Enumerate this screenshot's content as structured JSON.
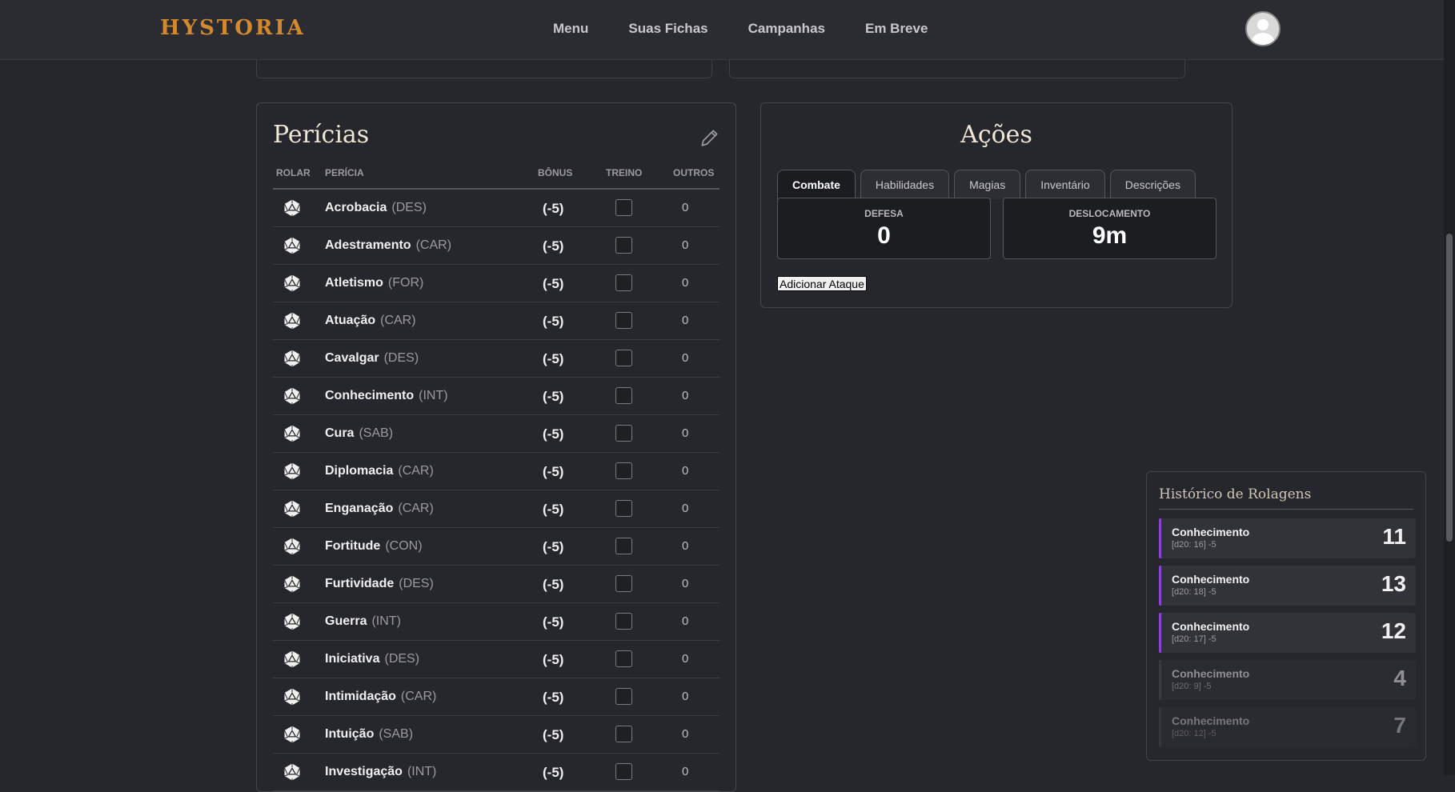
{
  "header": {
    "logo": "HYSTORIA",
    "nav": [
      "Menu",
      "Suas Fichas",
      "Campanhas",
      "Em Breve"
    ]
  },
  "skills": {
    "title": "Perícias",
    "columns": {
      "rolar": "ROLAR",
      "pericia": "PERÍCIA",
      "bonus": "BÔNUS",
      "treino": "TREINO",
      "outros": "OUTROS"
    },
    "rows": [
      {
        "name": "Acrobacia",
        "attr": "(DES)",
        "bonus": "(-5)",
        "outros": "0"
      },
      {
        "name": "Adestramento",
        "attr": "(CAR)",
        "bonus": "(-5)",
        "outros": "0"
      },
      {
        "name": "Atletismo",
        "attr": "(FOR)",
        "bonus": "(-5)",
        "outros": "0"
      },
      {
        "name": "Atuação",
        "attr": "(CAR)",
        "bonus": "(-5)",
        "outros": "0"
      },
      {
        "name": "Cavalgar",
        "attr": "(DES)",
        "bonus": "(-5)",
        "outros": "0"
      },
      {
        "name": "Conhecimento",
        "attr": "(INT)",
        "bonus": "(-5)",
        "outros": "0"
      },
      {
        "name": "Cura",
        "attr": "(SAB)",
        "bonus": "(-5)",
        "outros": "0"
      },
      {
        "name": "Diplomacia",
        "attr": "(CAR)",
        "bonus": "(-5)",
        "outros": "0"
      },
      {
        "name": "Enganação",
        "attr": "(CAR)",
        "bonus": "(-5)",
        "outros": "0"
      },
      {
        "name": "Fortitude",
        "attr": "(CON)",
        "bonus": "(-5)",
        "outros": "0"
      },
      {
        "name": "Furtividade",
        "attr": "(DES)",
        "bonus": "(-5)",
        "outros": "0"
      },
      {
        "name": "Guerra",
        "attr": "(INT)",
        "bonus": "(-5)",
        "outros": "0"
      },
      {
        "name": "Iniciativa",
        "attr": "(DES)",
        "bonus": "(-5)",
        "outros": "0"
      },
      {
        "name": "Intimidação",
        "attr": "(CAR)",
        "bonus": "(-5)",
        "outros": "0"
      },
      {
        "name": "Intuição",
        "attr": "(SAB)",
        "bonus": "(-5)",
        "outros": "0"
      },
      {
        "name": "Investigação",
        "attr": "(INT)",
        "bonus": "(-5)",
        "outros": "0"
      }
    ]
  },
  "acoes": {
    "title": "Ações",
    "tabs": [
      "Combate",
      "Habilidades",
      "Magias",
      "Inventário",
      "Descrições"
    ],
    "active_tab": "Combate",
    "defesa_label": "DEFESA",
    "defesa_value": "0",
    "deslocamento_label": "DESLOCAMENTO",
    "deslocamento_value": "9m",
    "add_attack": "Adicionar Ataque"
  },
  "history": {
    "title": "Histórico de Rolagens",
    "items": [
      {
        "name": "Conhecimento",
        "detail": "[d20: 16] -5",
        "result": "11"
      },
      {
        "name": "Conhecimento",
        "detail": "[d20: 18] -5",
        "result": "13"
      },
      {
        "name": "Conhecimento",
        "detail": "[d20: 17] -5",
        "result": "12"
      },
      {
        "name": "Conhecimento",
        "detail": "[d20: 9] -5",
        "result": "4"
      },
      {
        "name": "Conhecimento",
        "detail": "[d20: 12] -5",
        "result": "7"
      }
    ]
  },
  "colors": {
    "accent": "#8a45d8",
    "logo": "#d4892e",
    "background": "#1b1c20"
  },
  "icons": {
    "roll": "d20-dice-icon",
    "edit": "pencil-icon",
    "profile": "user-avatar-icon"
  }
}
